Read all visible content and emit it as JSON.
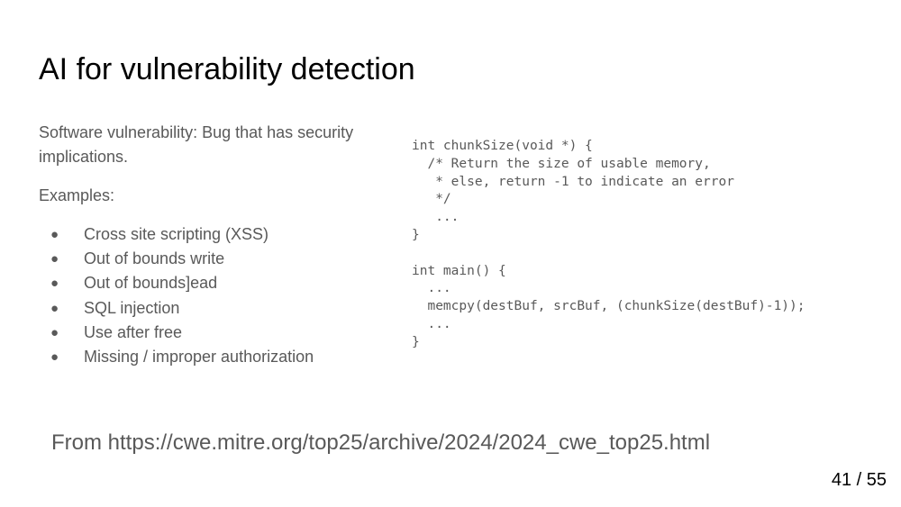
{
  "slide": {
    "title": "AI for vulnerability detection",
    "intro_line1": "Software vulnerability: Bug that has security",
    "intro_line2": "implications.",
    "examples_label": "Examples:",
    "bullet_glyph": "●",
    "examples": [
      "Cross site scripting (XSS)",
      "Out of bounds write",
      "Out of bounds]ead",
      "SQL injection",
      "Use after free",
      "Missing / improper authorization"
    ],
    "code": "int chunkSize(void *) {\n  /* Return the size of usable memory,\n   * else, return -1 to indicate an error\n   */\n   ...\n}\n\nint main() {\n  ...\n  memcpy(destBuf, srcBuf, (chunkSize(destBuf)-1));\n  ...\n}",
    "source": "From https://cwe.mitre.org/top25/archive/2024/2024_cwe_top25.html",
    "page_number": "41 / 55"
  }
}
